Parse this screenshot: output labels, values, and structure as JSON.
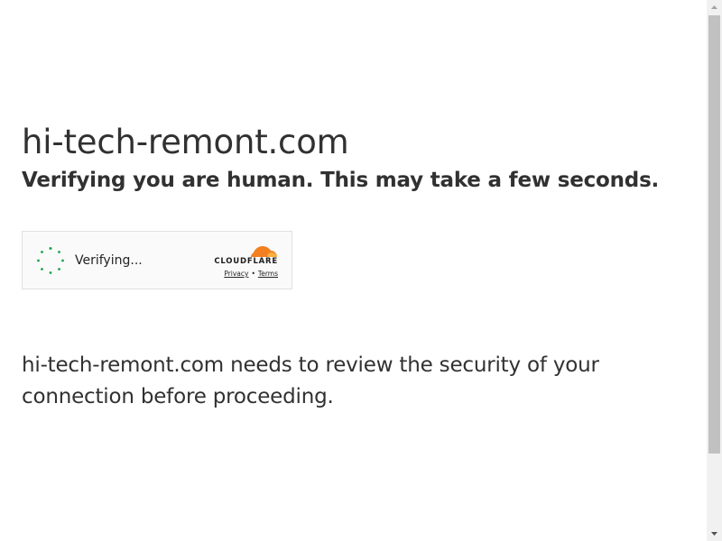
{
  "page": {
    "site_name": "hi-tech-remont.com",
    "subtitle": "Verifying you are human. This may take a few seconds.",
    "message": "hi-tech-remont.com needs to review the security of your connection before proceeding."
  },
  "widget": {
    "status_label": "Verifying...",
    "spinner_icon": "loading-spinner-icon",
    "brand_name": "CLOUDFLARE",
    "privacy_link": "Privacy",
    "separator": "•",
    "terms_link": "Terms"
  },
  "colors": {
    "text": "#313131",
    "spinner": "#1aa34a",
    "cloud_orange": "#f38020",
    "cloud_light_orange": "#faae40",
    "widget_bg": "#fafafa",
    "widget_border": "#e0e0e0",
    "scrollbar_track": "#f1f1f1",
    "scrollbar_thumb": "#c1c1c1"
  }
}
